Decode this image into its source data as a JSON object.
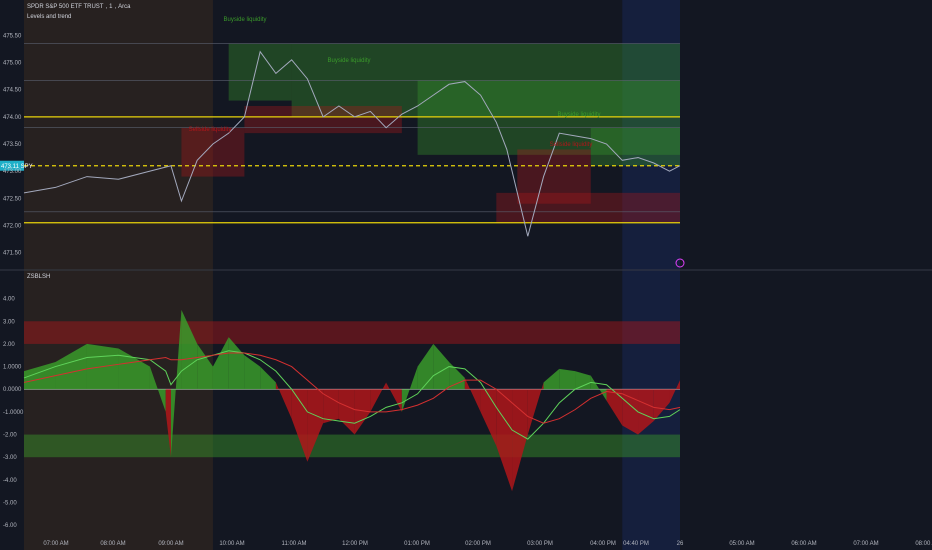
{
  "header": {
    "symbol": "SPDR S&P 500 ETF TRUST",
    "interval": "1",
    "exchange": "Arca",
    "indicator_name": "Levels and trend",
    "oscillator_name": "ZSBLSH"
  },
  "price_axis": {
    "ticks": [
      "475.50",
      "475.00",
      "474.50",
      "474.00",
      "473.50",
      "473.00",
      "472.50",
      "472.00",
      "471.50"
    ],
    "current_price_label": "473.11 SPY"
  },
  "osc_axis": {
    "ticks": [
      "4.00",
      "3.00",
      "2.00",
      "1.0000",
      "0.0000",
      "-1.0000",
      "-2.00",
      "-3.00",
      "-4.00",
      "-5.00",
      "-6.00"
    ]
  },
  "time_axis": {
    "ticks": [
      "07:00 AM",
      "08:00 AM",
      "09:00 AM",
      "10:00 AM",
      "11:00 AM",
      "12:00 PM",
      "01:00 PM",
      "02:00 PM",
      "03:00 PM",
      "04:00 PM",
      "04:40 PM",
      "26",
      "05:00 AM",
      "06:00 AM",
      "07:00 AM",
      "08:00 AM"
    ]
  },
  "annotations": {
    "buyside_1": "Buyside liquidity",
    "buyside_2": "Buyside liquidity",
    "buyside_3": "Buyside liquidity",
    "sellside_1": "Sellside liquidity",
    "sellside_2": "Sellside liquidity"
  },
  "chart_data": [
    {
      "type": "line",
      "title": "SPDR S&P 500 ETF TRUST, 1, Arca",
      "x": [
        "06:30",
        "07:00",
        "07:30",
        "08:00",
        "08:30",
        "08:50",
        "09:00",
        "09:15",
        "09:30",
        "09:45",
        "10:00",
        "10:15",
        "10:30",
        "10:45",
        "11:00",
        "11:15",
        "11:30",
        "11:45",
        "12:00",
        "12:15",
        "12:30",
        "12:45",
        "13:00",
        "13:15",
        "13:30",
        "13:45",
        "14:00",
        "14:10",
        "14:20",
        "14:30",
        "14:45",
        "15:00",
        "15:15",
        "15:30",
        "15:45",
        "16:00",
        "16:15",
        "16:30",
        "16:45",
        "16:55"
      ],
      "series": [
        {
          "values": [
            472.6,
            472.7,
            472.9,
            472.85,
            473.0,
            473.1,
            472.45,
            473.2,
            473.5,
            473.7,
            474.0,
            475.2,
            474.8,
            475.05,
            474.7,
            474.0,
            474.2,
            474.0,
            474.1,
            473.8,
            474.05,
            474.2,
            474.4,
            474.6,
            474.65,
            474.4,
            473.9,
            473.4,
            472.6,
            471.8,
            472.9,
            473.7,
            473.65,
            473.6,
            473.5,
            473.2,
            473.25,
            473.15,
            473.0,
            473.1
          ]
        }
      ],
      "levels": [
        475.35,
        474.67,
        474.0,
        473.8,
        473.1,
        472.25,
        472.05
      ],
      "ylim": [
        471.4,
        475.6
      ],
      "grid": false
    },
    {
      "type": "area",
      "title": "ZSBLSH",
      "x": [
        "06:30",
        "07:00",
        "07:30",
        "08:00",
        "08:30",
        "08:45",
        "08:50",
        "09:00",
        "09:15",
        "09:30",
        "09:45",
        "10:00",
        "10:15",
        "10:30",
        "10:45",
        "11:00",
        "11:15",
        "11:30",
        "11:45",
        "12:00",
        "12:15",
        "12:30",
        "12:45",
        "13:00",
        "13:15",
        "13:30",
        "13:45",
        "14:00",
        "14:15",
        "14:30",
        "14:45",
        "15:00",
        "15:15",
        "15:30",
        "15:45",
        "16:00",
        "16:15",
        "16:30",
        "16:45",
        "16:55"
      ],
      "series": [
        {
          "name": "value",
          "values": [
            0.8,
            1.2,
            2.0,
            1.8,
            1.0,
            -1.0,
            -3.0,
            3.5,
            2.0,
            1.0,
            2.3,
            1.5,
            1.0,
            0.3,
            -1.3,
            -3.2,
            -1.5,
            -1.3,
            -2.0,
            -1.0,
            0.3,
            -1.0,
            1.0,
            2.0,
            1.2,
            0.5,
            -1.0,
            -2.5,
            -4.5,
            -2.0,
            0.3,
            0.9,
            0.8,
            0.6,
            -0.5,
            -1.6,
            -2.0,
            -1.4,
            -0.6,
            0.4
          ]
        },
        {
          "name": "fast",
          "values": [
            0.5,
            1.0,
            1.4,
            1.5,
            1.3,
            0.8,
            0.2,
            0.8,
            1.3,
            1.5,
            1.7,
            1.6,
            1.3,
            0.8,
            0.0,
            -1.0,
            -1.3,
            -1.4,
            -1.5,
            -1.2,
            -0.8,
            -0.6,
            -0.2,
            0.6,
            1.0,
            0.9,
            0.3,
            -0.8,
            -1.8,
            -2.2,
            -1.5,
            -0.6,
            0.0,
            0.3,
            0.2,
            -0.4,
            -1.0,
            -1.3,
            -1.2,
            -0.9
          ]
        },
        {
          "name": "slow",
          "values": [
            0.3,
            0.6,
            0.9,
            1.1,
            1.3,
            1.4,
            1.3,
            1.3,
            1.4,
            1.5,
            1.6,
            1.6,
            1.5,
            1.3,
            1.0,
            0.4,
            -0.2,
            -0.6,
            -0.9,
            -1.0,
            -1.0,
            -0.9,
            -0.7,
            -0.4,
            0.1,
            0.4,
            0.4,
            0.0,
            -0.6,
            -1.2,
            -1.5,
            -1.3,
            -0.9,
            -0.4,
            -0.1,
            -0.2,
            -0.5,
            -0.8,
            -0.9,
            -0.8
          ]
        }
      ],
      "bands": [
        [
          2.0,
          3.0
        ],
        [
          -3.0,
          -2.0
        ]
      ],
      "ylim": [
        -6.3,
        4.6
      ],
      "grid": false
    }
  ],
  "colors": {
    "bg": "#131722",
    "premarket": "#2a2220",
    "afterhours": "#162040",
    "up": "#3a9a2a",
    "down": "#b0161a",
    "price": "#a3a9bd",
    "yellow": "#e8d30a",
    "zero": "#d1d4dc",
    "fast": "#5fd35a",
    "slow": "#d43030",
    "label_bg": "#1fb0c9"
  }
}
